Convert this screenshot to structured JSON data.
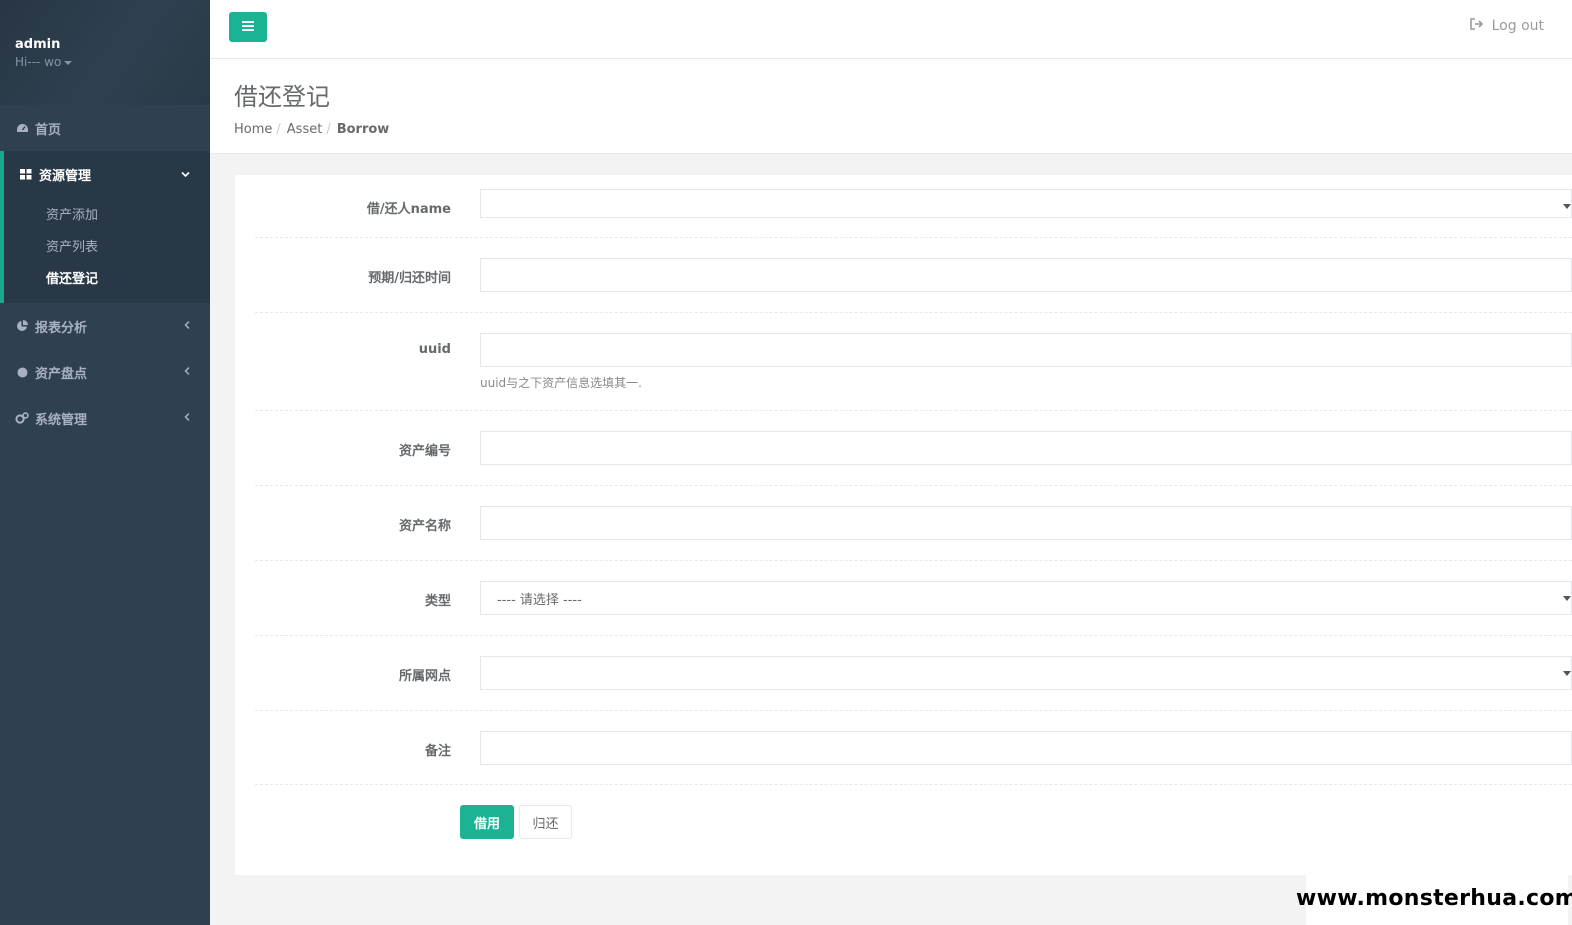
{
  "sidebar": {
    "profile": {
      "name": "admin",
      "role": "Hi--- wo"
    },
    "nav": {
      "home": "首页",
      "asset_mgmt": "资源管理",
      "asset_add": "资产添加",
      "asset_list": "资产列表",
      "borrow": "借还登记",
      "reports": "报表分析",
      "inventory": "资产盘点",
      "system": "系统管理"
    }
  },
  "topbar": {
    "logout": "Log out"
  },
  "heading": {
    "title": "借还登记",
    "breadcrumb": [
      "Home",
      "Asset",
      "Borrow"
    ]
  },
  "form": {
    "borrower_label": "借/还人name",
    "borrower_value": "",
    "time_label": "预期/归还时间",
    "uuid_label": "uuid",
    "uuid_help": "uuid与之下资产信息选填其一.",
    "asset_no_label": "资产编号",
    "asset_name_label": "资产名称",
    "type_label": "类型",
    "type_value": "---- 请选择 ----",
    "branch_label": "所属网点",
    "remark_label": "备注",
    "borrow_button": "借用",
    "return_button": "归还"
  },
  "watermark": "www.monsterhua.com",
  "colors": {
    "sidebar": "#2f4050",
    "accent": "#1ab394"
  }
}
